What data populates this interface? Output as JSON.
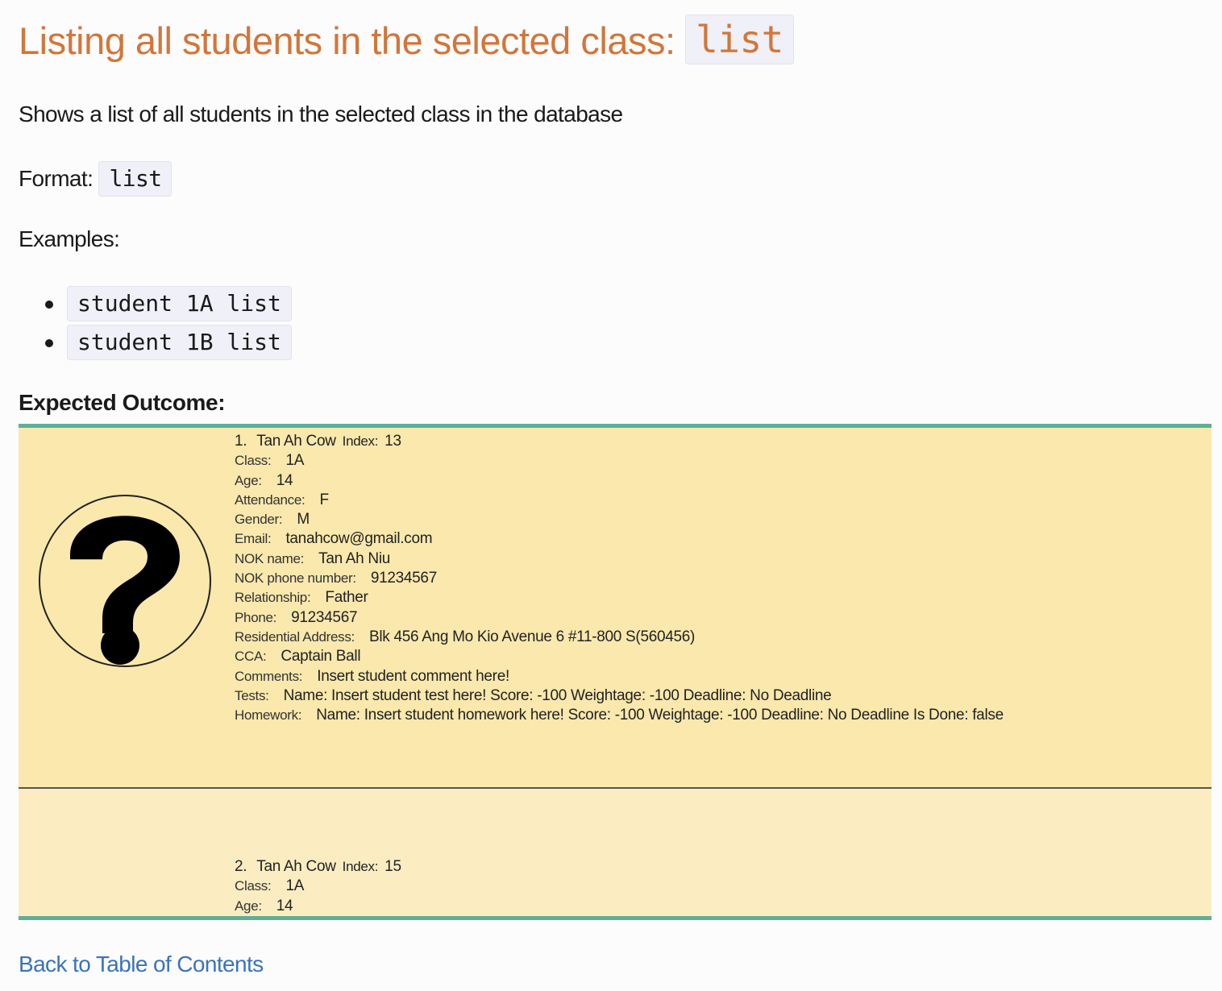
{
  "heading": {
    "text": "Listing all students in the selected class:",
    "code": "list"
  },
  "description": "Shows a list of all students in the selected class in the database",
  "format": {
    "label": "Format:",
    "code": "list"
  },
  "examples": {
    "label": "Examples:",
    "items": [
      "student 1A list",
      "student 1B list"
    ]
  },
  "outcome_label": "Expected Outcome:",
  "students": [
    {
      "number": "1.",
      "name": "Tan Ah Cow",
      "index_label": "Index:",
      "index": "13",
      "fields": [
        {
          "label": "Class:",
          "value": "1A"
        },
        {
          "label": "Age:",
          "value": "14"
        },
        {
          "label": "Attendance:",
          "value": "F"
        },
        {
          "label": "Gender:",
          "value": "M"
        },
        {
          "label": "Email:",
          "value": "tanahcow@gmail.com"
        },
        {
          "label": "NOK name:",
          "value": "Tan Ah Niu"
        },
        {
          "label": "NOK phone number:",
          "value": "91234567"
        },
        {
          "label": "Relationship:",
          "value": "Father"
        },
        {
          "label": "Phone:",
          "value": "91234567"
        },
        {
          "label": "Residential Address:",
          "value": "Blk 456 Ang Mo Kio Avenue 6 #11-800 S(560456)"
        },
        {
          "label": "CCA:",
          "value": "Captain Ball"
        },
        {
          "label": "Comments:",
          "value": "Insert student comment here!"
        },
        {
          "label": "Tests:",
          "value": "Name: Insert student test here! Score: -100 Weightage: -100 Deadline: No Deadline"
        },
        {
          "label": "Homework:",
          "value": "Name: Insert student homework here! Score: -100 Weightage: -100 Deadline: No Deadline Is Done: false"
        }
      ]
    },
    {
      "number": "2.",
      "name": "Tan Ah Cow",
      "index_label": "Index:",
      "index": "15",
      "fields": [
        {
          "label": "Class:",
          "value": "1A"
        },
        {
          "label": "Age:",
          "value": "14"
        }
      ]
    }
  ],
  "back_link": "Back to Table of Contents",
  "colors": {
    "heading": "#d2763a",
    "link": "#3b73b9",
    "card_border": "#5fae98",
    "card_bg": "#fae8ad"
  },
  "icons": {
    "avatar": "question-mark-icon"
  }
}
